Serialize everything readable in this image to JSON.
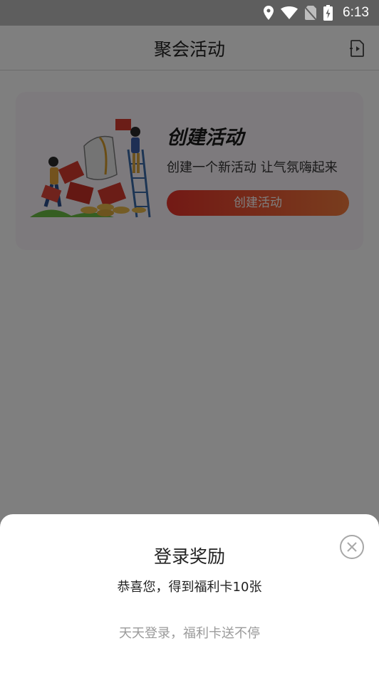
{
  "status_bar": {
    "time": "6:13",
    "icons": [
      "location-icon",
      "wifi-icon",
      "no-sim-icon",
      "battery-charging-icon"
    ]
  },
  "nav": {
    "title": "聚会活动",
    "right_icon": "share-file-icon"
  },
  "card": {
    "title": "创建活动",
    "subtitle": "创建一个新活动 让气氛嗨起来",
    "button_label": "创建活动",
    "button_colors": [
      "#e6332a",
      "#f27a3c"
    ]
  },
  "dialog": {
    "title": "登录奖励",
    "message": "恭喜您，得到福利卡10张",
    "footer": "天天登录，福利卡送不停",
    "close_icon": "close-circle-icon"
  },
  "colors": {
    "overlay": "rgba(0,0,0,0.5)",
    "card_bg": "#fbf5fb"
  }
}
